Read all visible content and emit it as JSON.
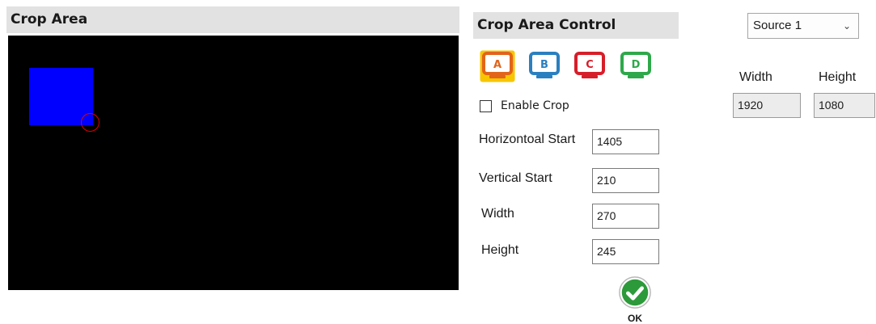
{
  "crop_area": {
    "title": "Crop Area"
  },
  "crop_control": {
    "title": "Crop Area Control",
    "presets": [
      {
        "label": "A",
        "color": "#f7c600",
        "frame_color": "#e2641a",
        "selected": true
      },
      {
        "label": "B",
        "color": "#2a7fc0",
        "frame_color": "#2a7fc0",
        "selected": false
      },
      {
        "label": "C",
        "color": "#d61e2a",
        "frame_color": "#d61e2a",
        "selected": false
      },
      {
        "label": "D",
        "color": "#2ea84a",
        "frame_color": "#2ea84a",
        "selected": false
      }
    ],
    "enable_crop": {
      "label": "Enable Crop",
      "checked": false
    },
    "fields": {
      "horizontal_start": {
        "label": "Horizontoal Start",
        "value": "1405"
      },
      "vertical_start": {
        "label": "Vertical Start",
        "value": "210"
      },
      "width": {
        "label": "Width",
        "value": "270"
      },
      "height": {
        "label": "Height",
        "value": "245"
      }
    },
    "ok_button": {
      "label": "OK"
    }
  },
  "source": {
    "selected": "Source 1",
    "width_label": "Width",
    "height_label": "Height",
    "width_value": "1920",
    "height_value": "1080"
  },
  "colors": {
    "crop_rect": "#0000ff",
    "preview_background": "#000000",
    "handle": "#e00000",
    "header_background": "#e2e2e2"
  },
  "icons": {
    "ok": "checkmark-icon",
    "dropdown": "chevron-down-icon"
  }
}
